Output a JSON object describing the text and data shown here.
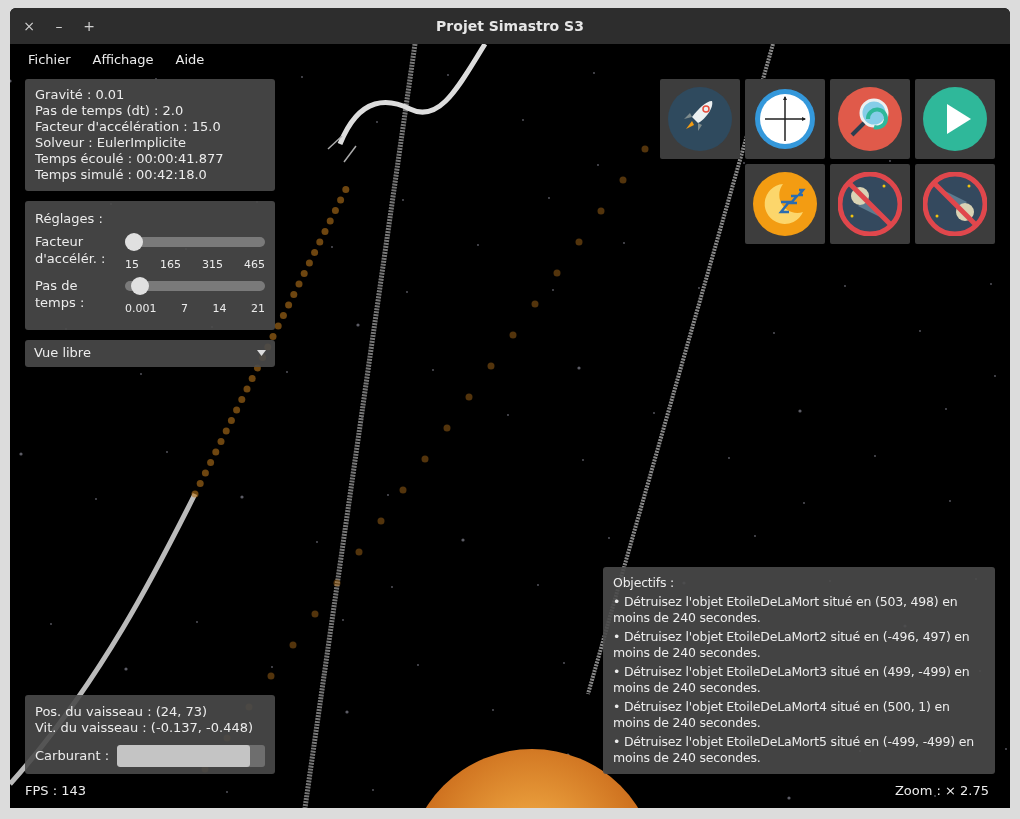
{
  "window": {
    "title": "Projet Simastro S3",
    "controls": [
      "×",
      "–",
      "+"
    ]
  },
  "menu": [
    "Fichier",
    "Affichage",
    "Aide"
  ],
  "info_panel": [
    "Gravité : 0.01",
    "Pas de temps (dt) : 2.0",
    "Facteur d'accélération : 15.0",
    "Solveur : EulerImplicite",
    "Temps écoulé : 00:00:41.877",
    "Temps simulé : 00:42:18.0"
  ],
  "settings": {
    "title": "Réglages :",
    "sliders": [
      {
        "label": "Facteur d'accélér. :",
        "level": 0.0,
        "ticks": [
          "15",
          "165",
          "315",
          "465"
        ]
      },
      {
        "label": "Pas de temps :",
        "level": 0.05,
        "ticks": [
          "0.001",
          "7",
          "14",
          "21"
        ]
      }
    ]
  },
  "view_select": {
    "value": "Vue libre"
  },
  "toolbar": [
    {
      "kind": "rocket"
    },
    {
      "kind": "axes"
    },
    {
      "kind": "reset-zoom"
    },
    {
      "kind": "play"
    },
    {
      "kind": "empty"
    },
    {
      "kind": "sleep"
    },
    {
      "kind": "no-asteroid-left"
    },
    {
      "kind": "no-asteroid-right"
    }
  ],
  "ship_panel": {
    "position": "Pos. du vaisseau : (24, 73)",
    "velocity": "Vit. du vaisseau : (-0.137, -0.448)",
    "fuel_label": "Carburant :",
    "fuel": {
      "level": 0.9
    }
  },
  "objectives": {
    "title": "Objectifs :",
    "items": [
      "• Détruisez l'objet EtoileDeLaMort situé en (503, 498) en moins de 240 secondes.",
      "• Détruisez l'objet EtoileDeLaMort2 situé en (-496, 497) en moins de 240 secondes.",
      "• Détruisez l'objet EtoileDeLaMort3 situé en (499, -499) en moins de 240 secondes.",
      "• Détruisez l'objet EtoileDeLaMort4 situé en (500, 1) en moins de 240 secondes.",
      "• Détruisez l'objet EtoileDeLaMort5 situé en (-499, -499) en moins de 240 secondes."
    ]
  },
  "status": {
    "fps": "FPS : 143",
    "zoom": "Zoom : × 2.75"
  }
}
